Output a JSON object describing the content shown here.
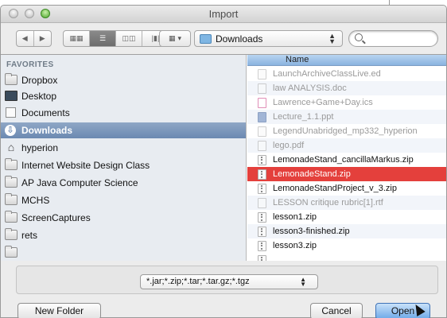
{
  "window": {
    "title": "Import"
  },
  "toolbar": {
    "back_icon": "back-arrow-icon",
    "forward_icon": "forward-arrow-icon",
    "view_modes": [
      "icon-view",
      "list-view",
      "column-view",
      "coverflow-view"
    ],
    "active_view": "list-view",
    "location": "Downloads",
    "search_placeholder": ""
  },
  "sidebar": {
    "heading": "FAVORITES",
    "items": [
      {
        "label": "Dropbox",
        "icon": "folder-icon"
      },
      {
        "label": "Desktop",
        "icon": "desktop-icon"
      },
      {
        "label": "Documents",
        "icon": "documents-icon"
      },
      {
        "label": "Downloads",
        "icon": "downloads-icon",
        "selected": true
      },
      {
        "label": "hyperion",
        "icon": "home-icon"
      },
      {
        "label": "Internet Website Design Class",
        "icon": "folder-icon"
      },
      {
        "label": "AP Java Computer Science",
        "icon": "folder-icon"
      },
      {
        "label": "MCHS",
        "icon": "folder-icon"
      },
      {
        "label": "ScreenCaptures",
        "icon": "folder-icon"
      },
      {
        "label": "rets",
        "icon": "folder-icon"
      }
    ]
  },
  "filelist": {
    "column_header": "Name",
    "files": [
      {
        "name": "LaunchArchiveClassLive.ed",
        "enabled": false
      },
      {
        "name": "law ANALYSIS.doc",
        "enabled": false
      },
      {
        "name": "Lawrence+Game+Day.ics",
        "enabled": false
      },
      {
        "name": "Lecture_1.1.ppt",
        "enabled": false
      },
      {
        "name": "LegendUnabridged_mp332_hyperion",
        "enabled": false
      },
      {
        "name": "lego.pdf",
        "enabled": false
      },
      {
        "name": "LemonadeStand_cancillaMarkus.zip",
        "enabled": true
      },
      {
        "name": "LemonadeStand.zip",
        "enabled": true,
        "selected": true
      },
      {
        "name": "LemonadeStandProject_v_3.zip",
        "enabled": true
      },
      {
        "name": "LESSON critique rubric[1].rtf",
        "enabled": false
      },
      {
        "name": "lesson1.zip",
        "enabled": true
      },
      {
        "name": "lesson3-finished.zip",
        "enabled": true
      },
      {
        "name": "lesson3.zip",
        "enabled": true
      }
    ]
  },
  "format": {
    "selected": "*.jar;*.zip;*.tar;*.tar.gz;*.tgz"
  },
  "buttons": {
    "new_folder": "New Folder",
    "cancel": "Cancel",
    "open": "Open"
  },
  "colors": {
    "selection_red": "#e4403c",
    "sidebar_selected": "#6b89b1",
    "header_blue": "#8ab3df"
  }
}
